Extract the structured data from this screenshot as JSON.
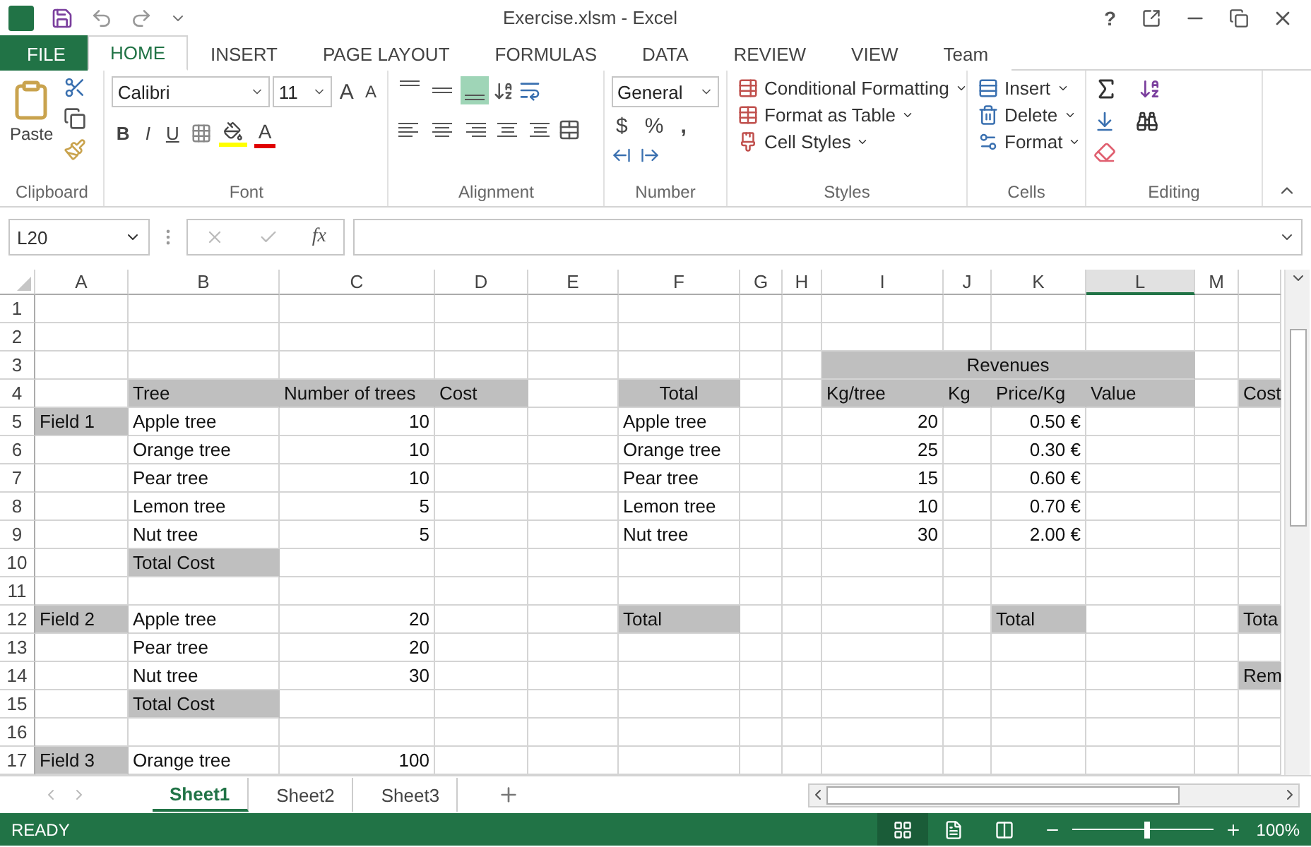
{
  "window": {
    "title": "Exercise.xlsm - Excel",
    "help": "?"
  },
  "tabs": [
    {
      "label": "FILE",
      "kind": "file",
      "selected": false
    },
    {
      "label": "HOME",
      "kind": "tab",
      "selected": true
    },
    {
      "label": "INSERT",
      "kind": "tab",
      "selected": false
    },
    {
      "label": "PAGE LAYOUT",
      "kind": "tab",
      "selected": false
    },
    {
      "label": "FORMULAS",
      "kind": "tab",
      "selected": false
    },
    {
      "label": "DATA",
      "kind": "tab",
      "selected": false
    },
    {
      "label": "REVIEW",
      "kind": "tab",
      "selected": false
    },
    {
      "label": "VIEW",
      "kind": "tab",
      "selected": false
    },
    {
      "label": "Team",
      "kind": "tab",
      "selected": false
    }
  ],
  "ribbon": {
    "clipboard": {
      "label": "Clipboard",
      "paste": "Paste"
    },
    "font": {
      "label": "Font",
      "name": "Calibri",
      "size": "11",
      "grow": "A",
      "shrink": "A",
      "bold": "B",
      "italic": "I",
      "underline": "U",
      "color_letter": "A"
    },
    "alignment": {
      "label": "Alignment",
      "top_row": [
        {
          "kind": "top",
          "selected": false
        },
        {
          "kind": "middle",
          "selected": false
        },
        {
          "kind": "bottom",
          "selected": true
        }
      ],
      "bottom_row": [
        {
          "kind": "left",
          "selected": false
        },
        {
          "kind": "center",
          "selected": false
        },
        {
          "kind": "right",
          "selected": false
        },
        {
          "kind": "outdent",
          "selected": false
        },
        {
          "kind": "indent",
          "selected": false
        }
      ]
    },
    "number": {
      "label": "Number",
      "format": "General",
      "currency": "$",
      "percent": "%",
      "comma": ","
    },
    "styles": {
      "label": "Styles",
      "items": [
        "Conditional Formatting",
        "Format as Table",
        "Cell Styles"
      ]
    },
    "cells": {
      "label": "Cells",
      "items": [
        "Insert",
        "Delete",
        "Format"
      ]
    },
    "editing": {
      "label": "Editing"
    }
  },
  "formula_bar": {
    "name_box": "L20",
    "fx": "fx"
  },
  "columns": [
    {
      "label": "A",
      "selected": false
    },
    {
      "label": "B",
      "selected": false
    },
    {
      "label": "C",
      "selected": false
    },
    {
      "label": "D",
      "selected": false
    },
    {
      "label": "E",
      "selected": false
    },
    {
      "label": "F",
      "selected": false
    },
    {
      "label": "G",
      "selected": false
    },
    {
      "label": "H",
      "selected": false
    },
    {
      "label": "I",
      "selected": false
    },
    {
      "label": "J",
      "selected": false
    },
    {
      "label": "K",
      "selected": false
    },
    {
      "label": "L",
      "selected": true
    },
    {
      "label": "M",
      "selected": false
    },
    {
      "selected": false
    }
  ],
  "rows": [
    {
      "label": "1",
      "cells": [
        {},
        {},
        {},
        {},
        {},
        {},
        {},
        {},
        {},
        {},
        {},
        {},
        {},
        {}
      ]
    },
    {
      "label": "2",
      "cells": [
        {},
        {},
        {},
        {},
        {},
        {},
        {},
        {},
        {},
        {},
        {},
        {},
        {},
        {}
      ]
    },
    {
      "label": "3",
      "cells": [
        {},
        {},
        {},
        {},
        {},
        {},
        {},
        {},
        {
          "text": "Revenues",
          "kind": "heading",
          "shaded": true
        },
        {
          "kind": "merged"
        },
        {
          "kind": "merged"
        },
        {
          "kind": "merged"
        },
        {},
        {}
      ]
    },
    {
      "label": "4",
      "cells": [
        {},
        {
          "text": "Tree",
          "kind": "label",
          "shaded": true
        },
        {
          "text": "Number of trees",
          "kind": "label",
          "shaded": true
        },
        {
          "text": "Cost",
          "kind": "label",
          "shaded": true
        },
        {},
        {
          "text": "Total",
          "kind": "heading",
          "shaded": true
        },
        {},
        {},
        {
          "text": "Kg/tree",
          "kind": "label",
          "shaded": true
        },
        {
          "text": "Kg",
          "kind": "label",
          "shaded": true
        },
        {
          "text": "Price/Kg",
          "kind": "label",
          "shaded": true
        },
        {
          "text": "Value",
          "kind": "label",
          "shaded": true
        },
        {},
        {
          "text": "Cost",
          "kind": "label",
          "shaded": true
        }
      ]
    },
    {
      "label": "5",
      "cells": [
        {
          "text": "Field 1",
          "kind": "label",
          "shaded": true
        },
        {
          "text": "Apple tree",
          "kind": "label"
        },
        {
          "text": "10",
          "kind": "number"
        },
        {},
        {},
        {
          "text": "Apple tree",
          "kind": "label"
        },
        {},
        {},
        {
          "text": "20",
          "kind": "number"
        },
        {},
        {
          "text": "0.50 €",
          "kind": "number"
        },
        {},
        {},
        {}
      ]
    },
    {
      "label": "6",
      "cells": [
        {},
        {
          "text": "Orange tree",
          "kind": "label"
        },
        {
          "text": "10",
          "kind": "number"
        },
        {},
        {},
        {
          "text": "Orange tree",
          "kind": "label"
        },
        {},
        {},
        {
          "text": "25",
          "kind": "number"
        },
        {},
        {
          "text": "0.30 €",
          "kind": "number"
        },
        {},
        {},
        {}
      ]
    },
    {
      "label": "7",
      "cells": [
        {},
        {
          "text": "Pear tree",
          "kind": "label"
        },
        {
          "text": "10",
          "kind": "number"
        },
        {},
        {},
        {
          "text": "Pear tree",
          "kind": "label"
        },
        {},
        {},
        {
          "text": "15",
          "kind": "number"
        },
        {},
        {
          "text": "0.60 €",
          "kind": "number"
        },
        {},
        {},
        {}
      ]
    },
    {
      "label": "8",
      "cells": [
        {},
        {
          "text": "Lemon tree",
          "kind": "label"
        },
        {
          "text": "5",
          "kind": "number"
        },
        {},
        {},
        {
          "text": "Lemon tree",
          "kind": "label"
        },
        {},
        {},
        {
          "text": "10",
          "kind": "number"
        },
        {},
        {
          "text": "0.70 €",
          "kind": "number"
        },
        {},
        {},
        {}
      ]
    },
    {
      "label": "9",
      "cells": [
        {},
        {
          "text": "Nut tree",
          "kind": "label"
        },
        {
          "text": "5",
          "kind": "number"
        },
        {},
        {},
        {
          "text": "Nut tree",
          "kind": "label"
        },
        {},
        {},
        {
          "text": "30",
          "kind": "number"
        },
        {},
        {
          "text": "2.00 €",
          "kind": "number"
        },
        {},
        {},
        {}
      ]
    },
    {
      "label": "10",
      "cells": [
        {},
        {
          "text": "Total Cost",
          "kind": "label",
          "shaded": true
        },
        {},
        {},
        {},
        {},
        {},
        {},
        {},
        {},
        {},
        {},
        {},
        {}
      ]
    },
    {
      "label": "11",
      "cells": [
        {},
        {},
        {},
        {},
        {},
        {},
        {},
        {},
        {},
        {},
        {},
        {},
        {},
        {}
      ]
    },
    {
      "label": "12",
      "cells": [
        {
          "text": "Field 2",
          "kind": "label",
          "shaded": true
        },
        {
          "text": "Apple tree",
          "kind": "label"
        },
        {
          "text": "20",
          "kind": "number"
        },
        {},
        {},
        {
          "text": "Total",
          "kind": "label",
          "shaded": true
        },
        {},
        {},
        {},
        {},
        {
          "text": "Total",
          "kind": "label",
          "shaded": true
        },
        {},
        {},
        {
          "text": "Tota",
          "kind": "label",
          "shaded": true
        }
      ]
    },
    {
      "label": "13",
      "cells": [
        {},
        {
          "text": "Pear tree",
          "kind": "label"
        },
        {
          "text": "20",
          "kind": "number"
        },
        {},
        {},
        {},
        {},
        {},
        {},
        {},
        {},
        {},
        {},
        {}
      ]
    },
    {
      "label": "14",
      "cells": [
        {},
        {
          "text": "Nut tree",
          "kind": "label"
        },
        {
          "text": "30",
          "kind": "number"
        },
        {},
        {},
        {},
        {},
        {},
        {},
        {},
        {},
        {},
        {},
        {
          "text": "Rem",
          "kind": "label",
          "shaded": true
        }
      ]
    },
    {
      "label": "15",
      "cells": [
        {},
        {
          "text": "Total Cost",
          "kind": "label",
          "shaded": true
        },
        {},
        {},
        {},
        {},
        {},
        {},
        {},
        {},
        {},
        {},
        {},
        {}
      ]
    },
    {
      "label": "16",
      "cells": [
        {},
        {},
        {},
        {},
        {},
        {},
        {},
        {},
        {},
        {},
        {},
        {},
        {},
        {}
      ]
    },
    {
      "label": "17",
      "cells": [
        {
          "text": "Field 3",
          "kind": "label",
          "shaded": true
        },
        {
          "text": "Orange tree",
          "kind": "label"
        },
        {
          "text": "100",
          "kind": "number"
        },
        {},
        {},
        {},
        {},
        {},
        {},
        {},
        {},
        {},
        {},
        {}
      ]
    }
  ],
  "sheets": [
    {
      "label": "Sheet1",
      "selected": true
    },
    {
      "label": "Sheet2",
      "selected": false
    },
    {
      "label": "Sheet3",
      "selected": false
    }
  ],
  "status_bar": {
    "status": "READY",
    "views": [
      {
        "kind": "normal",
        "selected": true
      },
      {
        "kind": "layout",
        "selected": false
      },
      {
        "kind": "break",
        "selected": false
      }
    ],
    "zoom": {
      "level": 0.53,
      "reading": "100%"
    }
  }
}
